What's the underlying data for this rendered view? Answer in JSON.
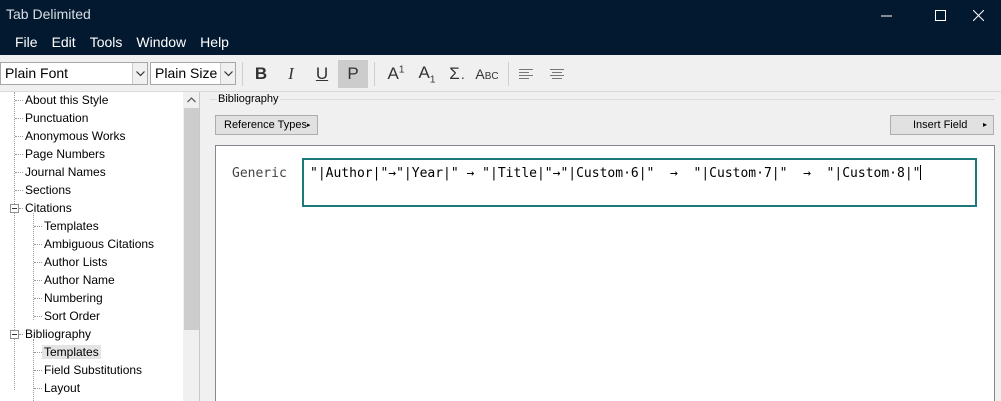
{
  "window": {
    "title": "Tab Delimited"
  },
  "menu": [
    "File",
    "Edit",
    "Tools",
    "Window",
    "Help"
  ],
  "toolbar": {
    "font_value": "Plain Font",
    "size_value": "Plain Size",
    "bold": "B",
    "italic": "I",
    "underline": "U",
    "plain": "P",
    "superscript": "A",
    "superscript_mark": "1",
    "subscript": "A",
    "subscript_mark": "1",
    "symbol": "Σ",
    "smallcaps": "ABC"
  },
  "tree": {
    "items": [
      "About this Style",
      "Punctuation",
      "Anonymous Works",
      "Page Numbers",
      "Journal Names",
      "Sections",
      "Citations",
      "Templates",
      "Ambiguous Citations",
      "Author Lists",
      "Author Name",
      "Numbering",
      "Sort Order",
      "Bibliography",
      "Templates",
      "Field Substitutions",
      "Layout"
    ],
    "selected_index": 14
  },
  "bibliography": {
    "group_label": "Bibliography",
    "reference_types_label": "Reference Types",
    "insert_field_label": "Insert Field",
    "generic_label": "Generic",
    "template_text": "\"|Author|\"→\"|Year|\" → \"|Title|\"→\"|Custom·6|\"  →  \"|Custom·7|\"  →  \"|Custom·8|\""
  },
  "colors": {
    "titlebar": "#03192f",
    "field_border": "#1e7a7a"
  }
}
